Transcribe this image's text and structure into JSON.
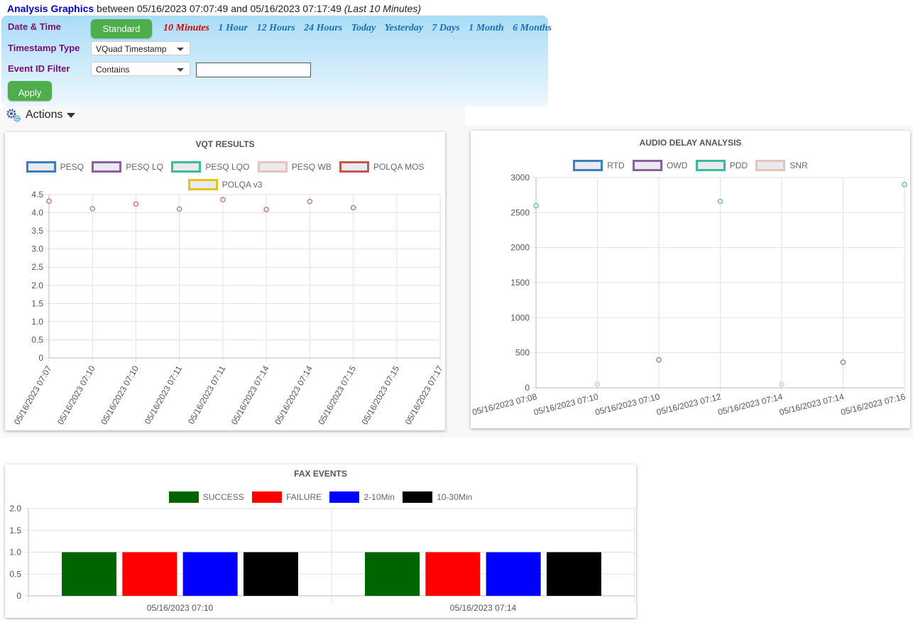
{
  "header": {
    "title": "Analysis Graphics",
    "between_text": " between 05/16/2023 07:07:49 and 05/16/2023 07:17:49 ",
    "range_label": "(Last 10 Minutes)"
  },
  "filters": {
    "date_time_label": "Date & Time",
    "standard_button": "Standard",
    "quick_ranges": [
      "10 Minutes",
      "1 Hour",
      "12 Hours",
      "24 Hours",
      "Today",
      "Yesterday",
      "7 Days",
      "1 Month",
      "6 Months"
    ],
    "active_range": "10 Minutes",
    "timestamp_type_label": "Timestamp Type",
    "timestamp_type_value": "VQuad Timestamp",
    "event_id_filter_label": "Event ID Filter",
    "event_id_filter_mode": "Contains",
    "event_id_filter_value": "",
    "apply_button": "Apply"
  },
  "actions": {
    "label": "Actions",
    "icon": "gears-icon"
  },
  "colors": {
    "accent_green": "#4cae4c",
    "active_range": "#e00000",
    "range_link": "#1a6fc0",
    "label_purple": "#7a0d80"
  },
  "chart_data": [
    {
      "id": "vqt",
      "type": "scatter",
      "title": "VQT RESULTS",
      "series": [
        {
          "name": "PESQ",
          "border": "#3a7fc4",
          "fill": "#e8eaee",
          "values": []
        },
        {
          "name": "PESQ LQ",
          "border": "#8e5ea2",
          "fill": "#e8eaee",
          "values": []
        },
        {
          "name": "PESQ LQO",
          "border": "#3cba9f",
          "fill": "#e8eaee",
          "values": []
        },
        {
          "name": "PESQ WB",
          "border": "#e8c3b9",
          "fill": "#e8eaee",
          "values": []
        },
        {
          "name": "POLQA MOS",
          "border": "#c45850",
          "fill": "#e8eaee",
          "values": [
            4.32,
            4.11,
            4.24,
            4.1,
            4.36,
            4.09,
            4.31,
            4.14,
            null,
            null
          ]
        },
        {
          "name": "POLQA v3",
          "border": "#e8c21a",
          "fill": "#e8eaee",
          "values": []
        }
      ],
      "categories": [
        "05/16/2023 07:07",
        "05/16/2023 07:10",
        "05/16/2023 07:10",
        "05/16/2023 07:11",
        "05/16/2023 07:11",
        "05/16/2023 07:14",
        "05/16/2023 07:14",
        "05/16/2023 07:15",
        "05/16/2023 07:15",
        "05/16/2023 07:17"
      ],
      "y_ticks": [
        "0",
        "0.5",
        "1.0",
        "1.5",
        "2.0",
        "2.5",
        "3.0",
        "3.5",
        "4.0",
        "4.5"
      ],
      "ylim": [
        0,
        4.5
      ],
      "grid": true,
      "legend": "top"
    },
    {
      "id": "audio-delay",
      "type": "scatter",
      "title": "AUDIO DELAY ANALYSIS",
      "series": [
        {
          "name": "RTD",
          "border": "#3a7fc4",
          "fill": "#e8eaee",
          "points": []
        },
        {
          "name": "OWD",
          "border": "#8e5ea2",
          "fill": "#e8eaee",
          "points": [
            [
              2,
              400
            ],
            [
              5,
              365
            ]
          ]
        },
        {
          "name": "PDD",
          "border": "#3cba9f",
          "fill": "#e8eaee",
          "points": [
            [
              0,
              2600
            ],
            [
              3,
              2660
            ],
            [
              6,
              2900
            ]
          ]
        },
        {
          "name": "SNR",
          "border": "#e8c3b9",
          "fill": "#e8eaee",
          "points": [
            [
              1,
              50
            ],
            [
              4,
              50
            ]
          ]
        }
      ],
      "categories": [
        "05/16/2023 07:08",
        "05/16/2023 07:10",
        "05/16/2023 07:10",
        "05/16/2023 07:12",
        "05/16/2023 07:14",
        "05/16/2023 07:14",
        "05/16/2023 07:16"
      ],
      "y_ticks": [
        "0",
        "500",
        "1000",
        "1500",
        "2000",
        "2500",
        "3000"
      ],
      "ylim": [
        0,
        3000
      ],
      "grid": true,
      "legend": "top"
    },
    {
      "id": "fax",
      "type": "bar",
      "title": "FAX EVENTS",
      "series": [
        {
          "name": "SUCCESS",
          "color": "#006400",
          "values": [
            1,
            1
          ]
        },
        {
          "name": "FAILURE",
          "color": "#ff0000",
          "values": [
            1,
            1
          ]
        },
        {
          "name": "2-10Min",
          "color": "#0000ff",
          "values": [
            1,
            1
          ]
        },
        {
          "name": "10-30Min",
          "color": "#000000",
          "values": [
            1,
            1
          ]
        }
      ],
      "categories": [
        "05/16/2023 07:10",
        "05/16/2023 07:14"
      ],
      "y_ticks": [
        "0",
        "0.5",
        "1.0",
        "1.5",
        "2.0"
      ],
      "ylim": [
        0,
        2
      ],
      "grid": true,
      "legend": "top"
    }
  ]
}
